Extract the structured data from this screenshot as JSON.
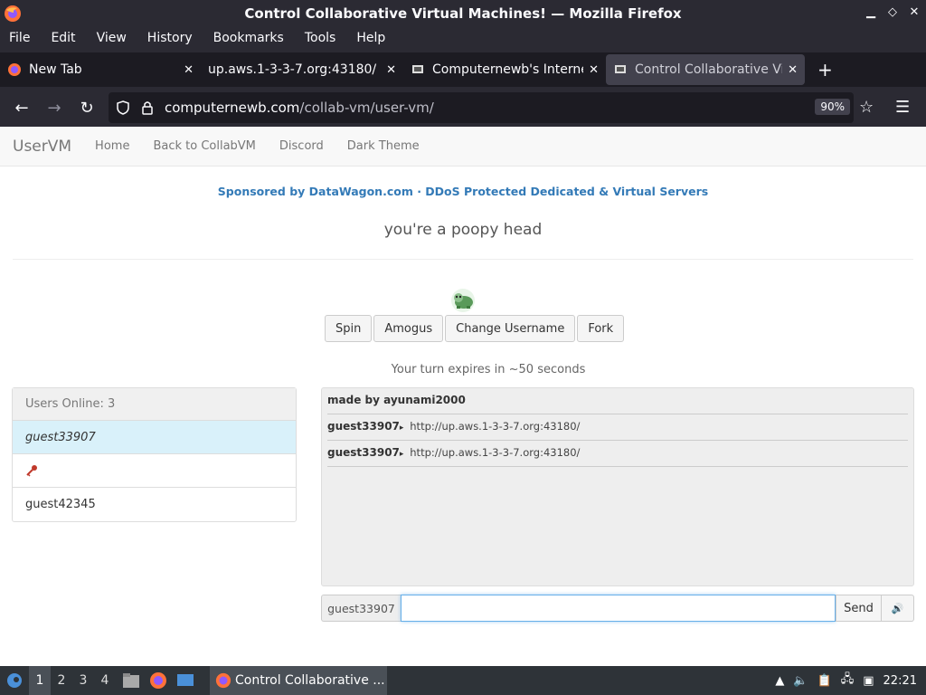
{
  "window": {
    "title": "Control Collaborative Virtual Machines! — Mozilla Firefox"
  },
  "menu": [
    "File",
    "Edit",
    "View",
    "History",
    "Bookmarks",
    "Tools",
    "Help"
  ],
  "tabs": [
    {
      "label": "New Tab",
      "icon": "firefox-icon"
    },
    {
      "label": "up.aws.1-3-3-7.org:43180/",
      "icon": "none"
    },
    {
      "label": "Computernewb's Internet",
      "icon": "computernewb-icon"
    },
    {
      "label": "Control Collaborative Virt",
      "icon": "computernewb-icon",
      "active": true
    }
  ],
  "urlbar": {
    "host": "computernewb.com",
    "path": "/collab-vm/user-vm/",
    "zoom": "90%"
  },
  "site": {
    "brand": "UserVM",
    "nav": [
      "Home",
      "Back to CollabVM",
      "Discord",
      "Dark Theme"
    ],
    "sponsor": "Sponsored by DataWagon.com · DDoS Protected Dedicated & Virtual Servers",
    "motd": "you're a poopy head",
    "buttons": [
      "Spin",
      "Amogus",
      "Change Username",
      "Fork"
    ],
    "turn_text": "Your turn expires in ~50 seconds"
  },
  "users": {
    "header": "Users Online: 3",
    "list": [
      {
        "name": "guest33907",
        "me": true
      },
      {
        "name": "",
        "icon": "key-icon"
      },
      {
        "name": "guest42345"
      }
    ]
  },
  "chat": {
    "messages": [
      {
        "user": "made by ayunami2000",
        "text": ""
      },
      {
        "user": "guest33907",
        "text": "http://up.aws.1-3-3-7.org:43180/"
      },
      {
        "user": "guest33907",
        "text": "http://up.aws.1-3-3-7.org:43180/"
      }
    ],
    "username": "guest33907",
    "input_value": "",
    "send_label": "Send"
  },
  "taskbar": {
    "workspaces": [
      "1",
      "2",
      "3",
      "4"
    ],
    "window_label": "Control Collaborative ...",
    "clock": "22:21"
  },
  "colors": {
    "link": "#337ab7",
    "chrome_bg": "#2b2a33",
    "highlight_row": "#d9f1fa"
  }
}
